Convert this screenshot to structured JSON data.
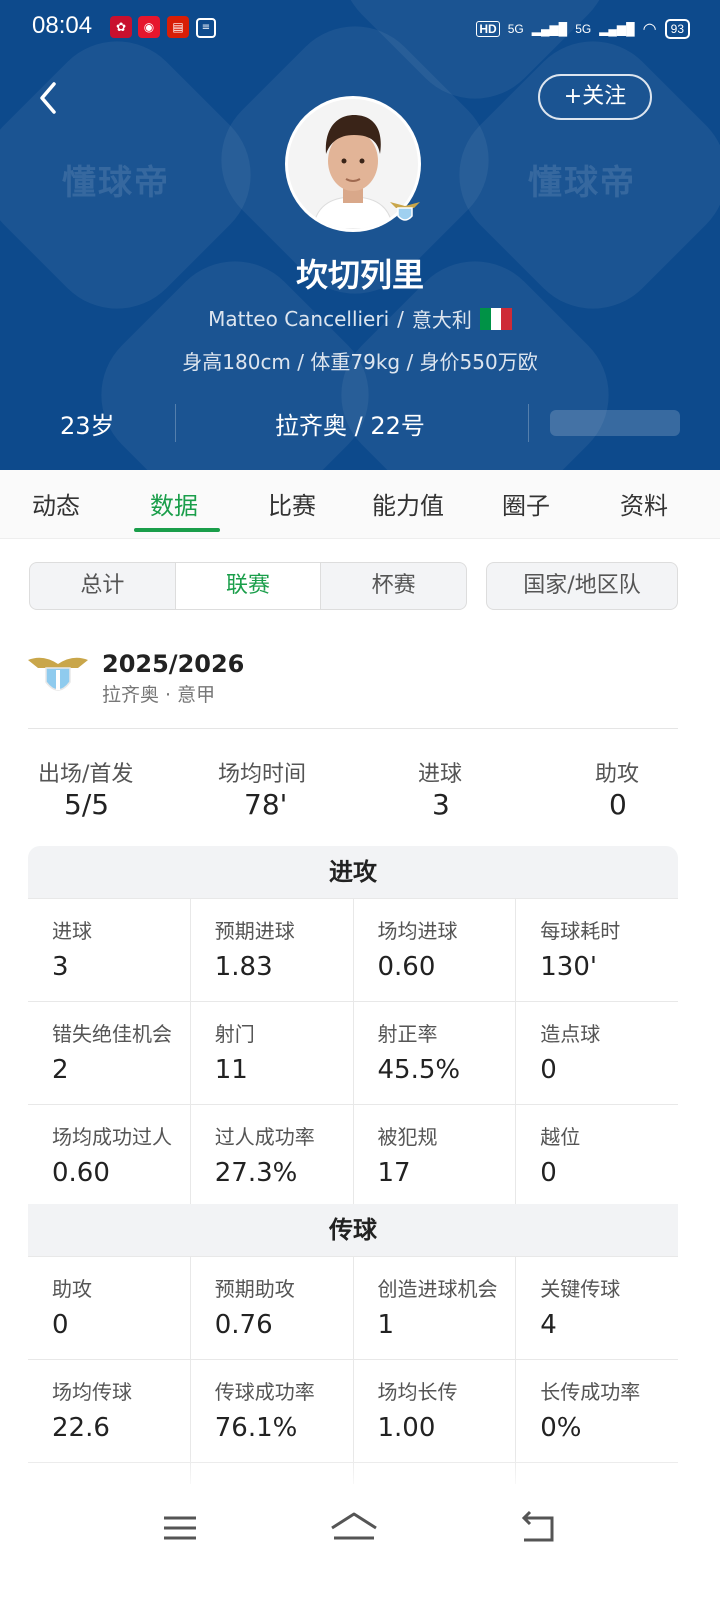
{
  "status_bar": {
    "time": "08:04",
    "network_1": "5G",
    "network_2": "5G",
    "battery": "93"
  },
  "header": {
    "follow_label": "+关注",
    "watermark": "懂球帝"
  },
  "player": {
    "name": "坎切列里",
    "name_en": "Matteo Cancellieri",
    "nationality": "意大利",
    "physical": "身高180cm / 体重79kg / 身价550万欧",
    "age": "23岁",
    "club_number": "拉齐奥 / 22号",
    "flag_colors": [
      "#009246",
      "#ffffff",
      "#ce2b37"
    ]
  },
  "tabs": [
    "动态",
    "数据",
    "比赛",
    "能力值",
    "圈子",
    "资料"
  ],
  "active_tab": "数据",
  "segments": [
    "总计",
    "联赛",
    "杯赛"
  ],
  "active_segment": "联赛",
  "segment_national": "国家/地区队",
  "season": {
    "year": "2025/2026",
    "competition": "拉齐奥 · 意甲"
  },
  "summary": [
    {
      "label": "出场/首发",
      "value": "5/5"
    },
    {
      "label": "场均时间",
      "value": "78'"
    },
    {
      "label": "进球",
      "value": "3"
    },
    {
      "label": "助攻",
      "value": "0"
    }
  ],
  "attack": {
    "title": "进攻",
    "rows": [
      [
        {
          "label": "进球",
          "value": "3"
        },
        {
          "label": "预期进球",
          "value": "1.83"
        },
        {
          "label": "场均进球",
          "value": "0.60"
        },
        {
          "label": "每球耗时",
          "value": "130'"
        }
      ],
      [
        {
          "label": "错失绝佳机会",
          "value": "2"
        },
        {
          "label": "射门",
          "value": "11"
        },
        {
          "label": "射正率",
          "value": "45.5%"
        },
        {
          "label": "造点球",
          "value": "0"
        }
      ],
      [
        {
          "label": "场均成功过人",
          "value": "0.60"
        },
        {
          "label": "过人成功率",
          "value": "27.3%"
        },
        {
          "label": "被犯规",
          "value": "17"
        },
        {
          "label": "越位",
          "value": "0"
        }
      ]
    ]
  },
  "passing": {
    "title": "传球",
    "rows": [
      [
        {
          "label": "助攻",
          "value": "0"
        },
        {
          "label": "预期助攻",
          "value": "0.76"
        },
        {
          "label": "创造进球机会",
          "value": "1"
        },
        {
          "label": "关键传球",
          "value": "4"
        }
      ],
      [
        {
          "label": "场均传球",
          "value": "22.6"
        },
        {
          "label": "传球成功率",
          "value": "76.1%"
        },
        {
          "label": "场均长传",
          "value": "1.00"
        },
        {
          "label": "长传成功率",
          "value": "0%"
        }
      ]
    ]
  },
  "colors": {
    "hero_bg": "#0d4a8c",
    "accent": "#1a9e4a"
  }
}
